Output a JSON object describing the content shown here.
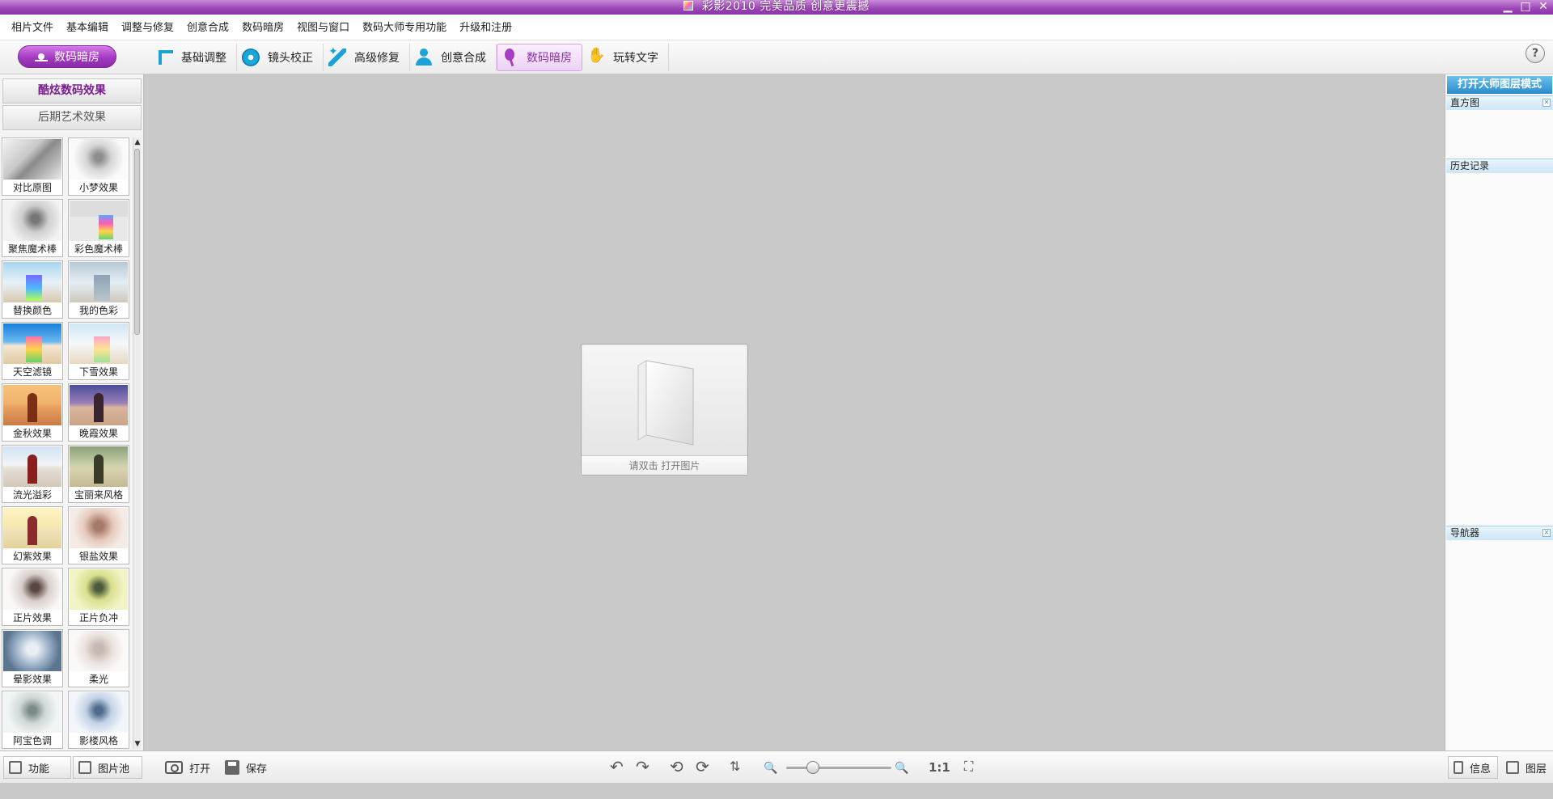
{
  "window": {
    "title": "彩影2010  完美品质 创意更震撼",
    "minimize": "▁",
    "maximize": "□",
    "close": "✕"
  },
  "menu": [
    "相片文件",
    "基本编辑",
    "调整与修复",
    "创意合成",
    "数码暗房",
    "视图与窗口",
    "数码大师专用功能",
    "升级和注册"
  ],
  "toolbar": {
    "mode_label": "数码暗房",
    "tools": [
      {
        "label": "基础调整",
        "icon": "adjust-icon"
      },
      {
        "label": "镜头校正",
        "icon": "lens-icon"
      },
      {
        "label": "高级修复",
        "icon": "repair-icon"
      },
      {
        "label": "创意合成",
        "icon": "creative-icon"
      },
      {
        "label": "数码暗房",
        "icon": "darkroom-icon",
        "active": true
      },
      {
        "label": "玩转文字",
        "icon": "text-icon"
      }
    ],
    "help": "?"
  },
  "left": {
    "categories": [
      "酷炫数码效果",
      "后期艺术效果"
    ],
    "effects": [
      "对比原图",
      "小梦效果",
      "聚焦魔术棒",
      "彩色魔术棒",
      "替换颜色",
      "我的色彩",
      "天空滤镜",
      "下雪效果",
      "金秋效果",
      "晚霞效果",
      "流光溢彩",
      "宝丽来风格",
      "幻紫效果",
      "银盐效果",
      "正片效果",
      "正片负冲",
      "晕影效果",
      "柔光",
      "阿宝色调",
      "影楼风格"
    ]
  },
  "canvas": {
    "hint": "请双击  打开图片"
  },
  "right": {
    "master_button": "打开大师图层模式",
    "panels": [
      "直方图",
      "历史记录",
      "导航器"
    ]
  },
  "status": {
    "function_label": "功能",
    "pool_label": "图片池",
    "open_label": "打开",
    "save_label": "保存",
    "ratio_label": "1:1",
    "info_label": "信息",
    "layers_label": "图层",
    "zoom_percent": 25
  },
  "colors": {
    "accent": "#9b45b5",
    "panel_head": "#cde6f5",
    "master_button": "#2a8bcc"
  }
}
